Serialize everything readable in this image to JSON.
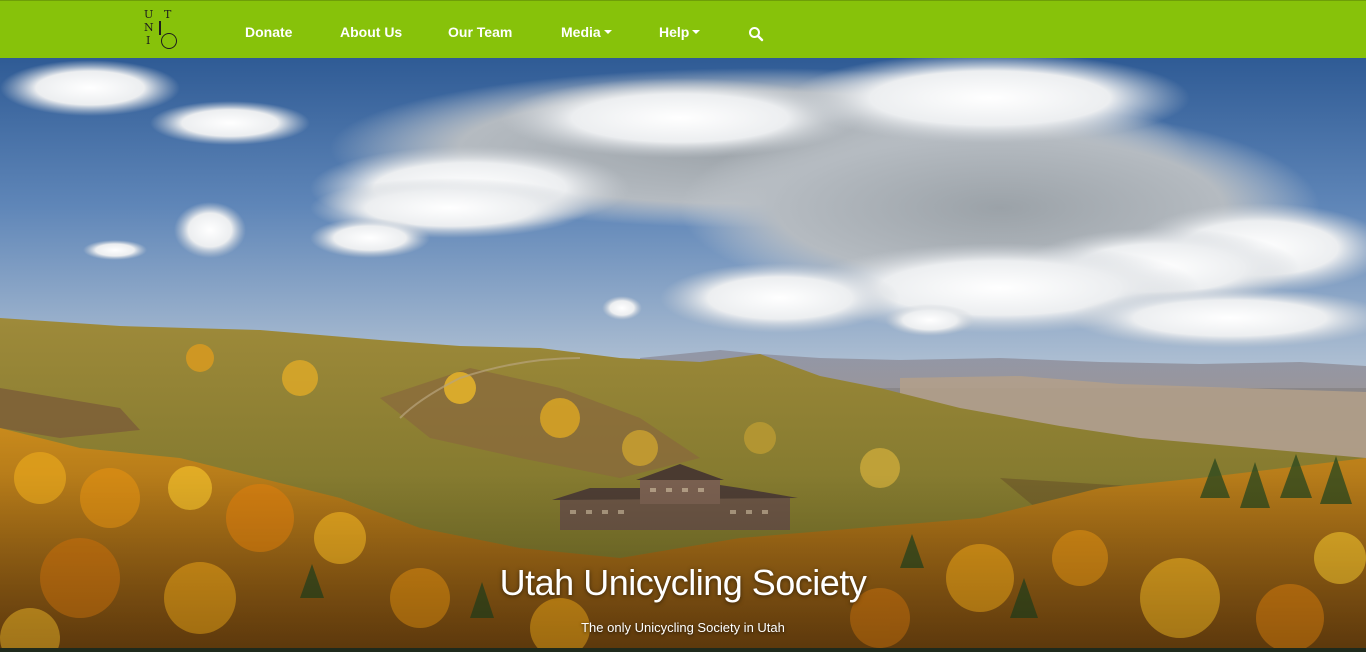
{
  "nav": {
    "logo_letters": [
      "U",
      "T",
      "N",
      "I"
    ],
    "items": [
      {
        "label": "Donate",
        "dropdown": false
      },
      {
        "label": "About Us",
        "dropdown": false
      },
      {
        "label": "Our Team",
        "dropdown": false
      },
      {
        "label": "Media",
        "dropdown": true
      },
      {
        "label": "Help",
        "dropdown": true
      }
    ],
    "search_icon": "search-icon",
    "background_color": "#87c20a",
    "text_color": "#ffffff"
  },
  "hero": {
    "title": "Utah Unicycling Society",
    "subtitle": "The only Unicycling Society in Utah",
    "image_subject": "autumn mountain landscape with aspen forest and lodge"
  }
}
